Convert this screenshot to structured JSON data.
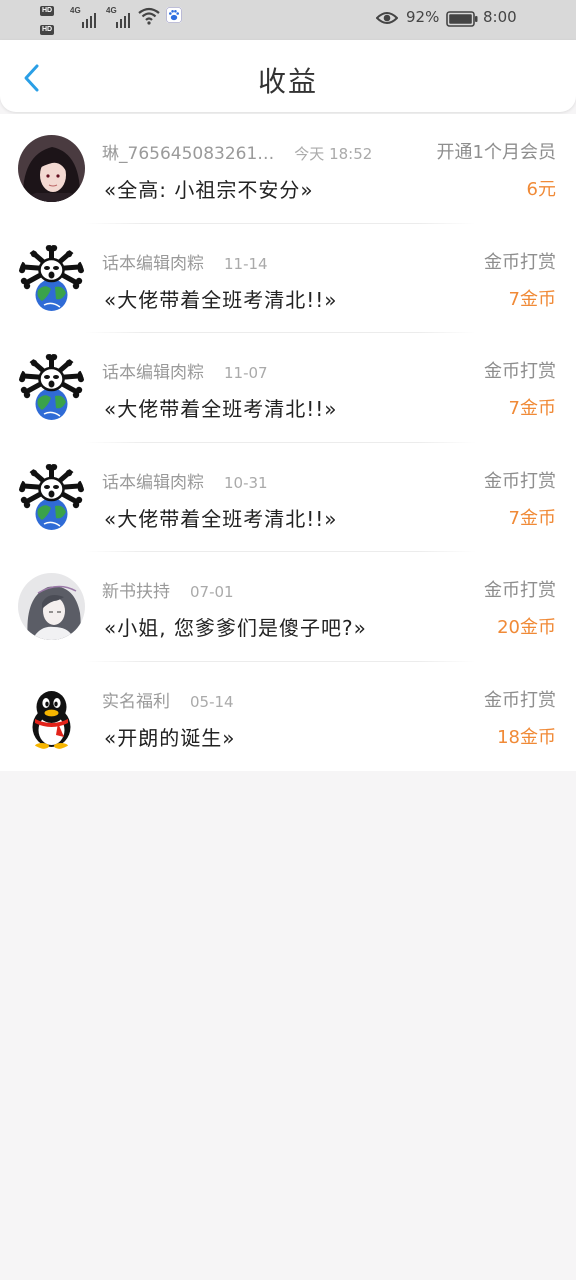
{
  "status_bar": {
    "hd1": "HD",
    "hd2": "HD",
    "net1": "4G",
    "net2": "4G",
    "battery_percent": "92%",
    "time": "8:00"
  },
  "nav": {
    "title": "收益",
    "back_icon": "chevron-left-icon"
  },
  "colors": {
    "accent": "#2a9fe6",
    "amount": "#f08a37",
    "secondary_text": "#9a9a9a"
  },
  "records": [
    {
      "avatar": "anime-girl-avatar",
      "name": "琳_765645083261…",
      "date": "今天 18:52",
      "type": "开通1个月会员",
      "title": "«全高: 小祖宗不安分»",
      "amount": "6元"
    },
    {
      "avatar": "skull-globe-avatar",
      "name": "话本编辑肉粽",
      "date": "11-14",
      "type": "金币打赏",
      "title": "«大佬带着全班考清北!!»",
      "amount": "7金币"
    },
    {
      "avatar": "skull-globe-avatar",
      "name": "话本编辑肉粽",
      "date": "11-07",
      "type": "金币打赏",
      "title": "«大佬带着全班考清北!!»",
      "amount": "7金币"
    },
    {
      "avatar": "skull-globe-avatar",
      "name": "话本编辑肉粽",
      "date": "10-31",
      "type": "金币打赏",
      "title": "«大佬带着全班考清北!!»",
      "amount": "7金币"
    },
    {
      "avatar": "ink-portrait-avatar",
      "name": "新书扶持",
      "date": "07-01",
      "type": "金币打赏",
      "title": "«小姐, 您爹爹们是傻子吧?»",
      "amount": "20金币"
    },
    {
      "avatar": "penguin-avatar",
      "name": "实名福利",
      "date": "05-14",
      "type": "金币打赏",
      "title": "«开朗的诞生»",
      "amount": "18金币"
    }
  ]
}
